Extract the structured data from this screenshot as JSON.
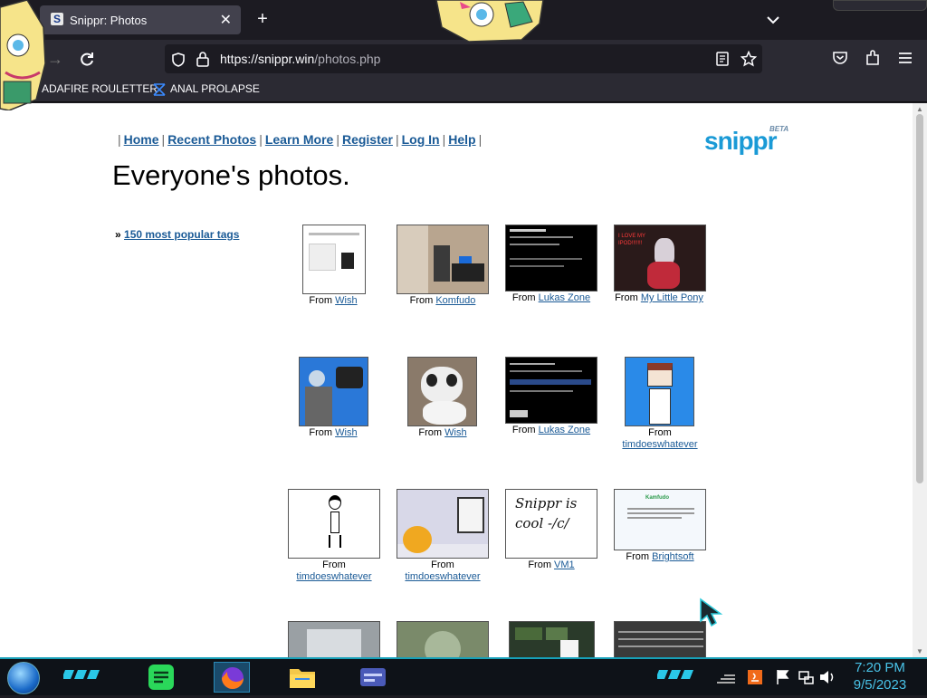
{
  "browser": {
    "tab_title": "Snippr: Photos",
    "tab_favicon": "S",
    "url_host": "https://snippr.win",
    "url_path": "/photos.php",
    "bookmarks": [
      "ADAFIRE ROULETTER",
      "ANAL PROLAPSE"
    ]
  },
  "page": {
    "nav": [
      "Home",
      "Recent Photos",
      "Learn More",
      "Register",
      "Log In",
      "Help"
    ],
    "logo_text": "snippr",
    "logo_badge": "BETA",
    "title": "Everyone's photos.",
    "tags_prefix": "»",
    "tags_link": "150 most popular tags",
    "from_label": "From",
    "photos": [
      {
        "source": "Wish"
      },
      {
        "source": "Komfudo"
      },
      {
        "source": "Lukas Zone"
      },
      {
        "source": "My Little Pony",
        "thumb_text": "I LOVE MY IPOD!!!!!!!"
      },
      {
        "source": "Wish"
      },
      {
        "source": "Wish"
      },
      {
        "source": "Lukas Zone"
      },
      {
        "source": "timdoeswhatever"
      },
      {
        "source": "timdoeswhatever"
      },
      {
        "source": "timdoeswhatever"
      },
      {
        "source": "VM1",
        "thumb_text": "Snippr is cool -/c/"
      },
      {
        "source": "Brightsoft",
        "thumb_text": "Kamfudo"
      }
    ]
  },
  "taskbar": {
    "time": "7:20 PM",
    "date": "9/5/2023"
  },
  "colors": {
    "link": "#1a5a96",
    "logo": "#1a9ad6",
    "taskbar_accent": "#17a0b8",
    "clock": "#49c3e8"
  }
}
